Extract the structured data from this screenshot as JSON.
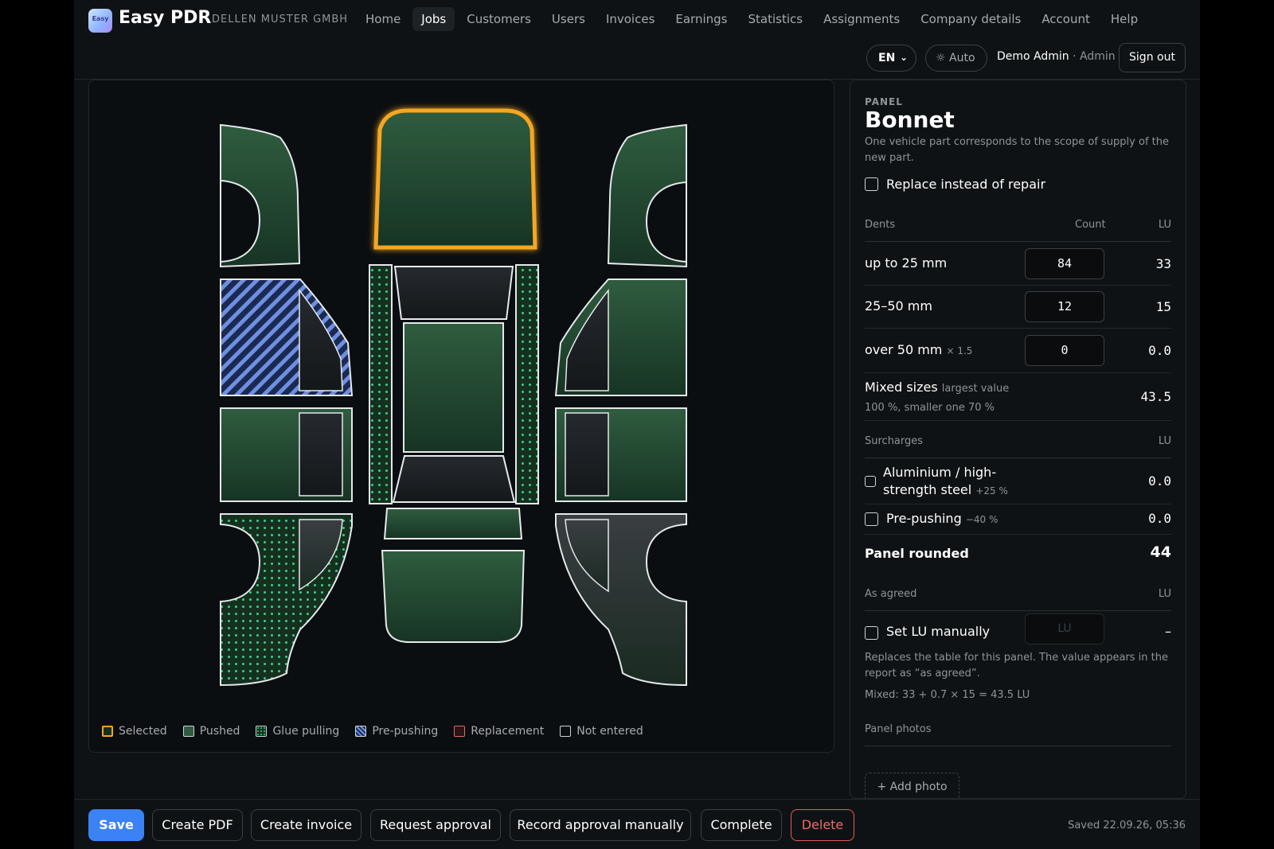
{
  "header": {
    "logo_text": "Easy",
    "brand": "Easy PDR",
    "company": "DELLEN MUSTER GMBH",
    "nav": [
      {
        "label": "Home",
        "active": false
      },
      {
        "label": "Jobs",
        "active": true
      },
      {
        "label": "Customers",
        "active": false
      },
      {
        "label": "Users",
        "active": false
      },
      {
        "label": "Invoices",
        "active": false
      },
      {
        "label": "Earnings",
        "active": false
      },
      {
        "label": "Statistics",
        "active": false
      },
      {
        "label": "Assignments",
        "active": false
      },
      {
        "label": "Company details",
        "active": false
      },
      {
        "label": "Account",
        "active": false
      },
      {
        "label": "Help",
        "active": false
      }
    ],
    "language": "EN",
    "theme": "Auto",
    "user_name": "Demo Admin",
    "user_separator": " · ",
    "user_role": "Admin",
    "sign_out": "Sign out"
  },
  "legend": [
    {
      "label": "Selected",
      "key": "selected"
    },
    {
      "label": "Pushed",
      "key": "pushed"
    },
    {
      "label": "Glue pulling",
      "key": "glue"
    },
    {
      "label": "Pre-pushing",
      "key": "prepush"
    },
    {
      "label": "Replacement",
      "key": "replacement"
    },
    {
      "label": "Not entered",
      "key": "none"
    }
  ],
  "colors": {
    "selected": "#f5a623",
    "pushed": "#2e5a3d",
    "glue_dot": "#3ccf86",
    "prepush": "#6f8fe0",
    "replacement": "#e06a6a",
    "primary": "#3b82f6",
    "danger": "#e25b5b"
  },
  "panel": {
    "eyebrow": "PANEL",
    "title": "Bonnet",
    "description": "One vehicle part corresponds to the scope of supply of the new part.",
    "replace_label": "Replace instead of repair",
    "dents": {
      "header": {
        "label": "Dents",
        "count": "Count",
        "lu": "LU"
      },
      "rows": [
        {
          "label": "up to 25 mm",
          "multiplier": "",
          "count": "84",
          "lu": "33"
        },
        {
          "label": "25–50 mm",
          "multiplier": "",
          "count": "12",
          "lu": "15"
        },
        {
          "label": "over 50 mm",
          "multiplier": "× 1.5",
          "count": "0",
          "lu": "0.0"
        }
      ],
      "mixed_label": "Mixed sizes",
      "mixed_note_1": "largest value",
      "mixed_note_2": "100 %, smaller one 70 %",
      "mixed_value": "43.5"
    },
    "surcharges": {
      "header": {
        "label": "Surcharges",
        "lu": "LU"
      },
      "aluminium_label_1": "Aluminium / high-",
      "aluminium_label_2": "strength steel",
      "aluminium_pct": "+25 %",
      "aluminium_value": "0.0",
      "prepush_label": "Pre-pushing",
      "prepush_pct": "−40 %",
      "prepush_value": "0.0"
    },
    "panel_rounded_label": "Panel rounded",
    "panel_rounded_value": "44",
    "agreed": {
      "header": {
        "label": "As agreed",
        "lu": "LU"
      },
      "manual_label": "Set LU manually",
      "manual_placeholder": "LU",
      "manual_value": "–",
      "note": "Replaces the table for this panel. The value appears in the report as “as agreed”.",
      "formula": "Mixed: 33 + 0.7 × 15 = 43.5 LU"
    },
    "photos_label": "Panel photos",
    "add_photo": "+ Add photo"
  },
  "footer": {
    "save": "Save",
    "create_pdf": "Create PDF",
    "create_invoice": "Create invoice",
    "request_approval": "Request approval",
    "record_approval": "Record approval manually",
    "complete": "Complete",
    "delete": "Delete",
    "saved": "Saved 22.09.26, 05:36"
  }
}
